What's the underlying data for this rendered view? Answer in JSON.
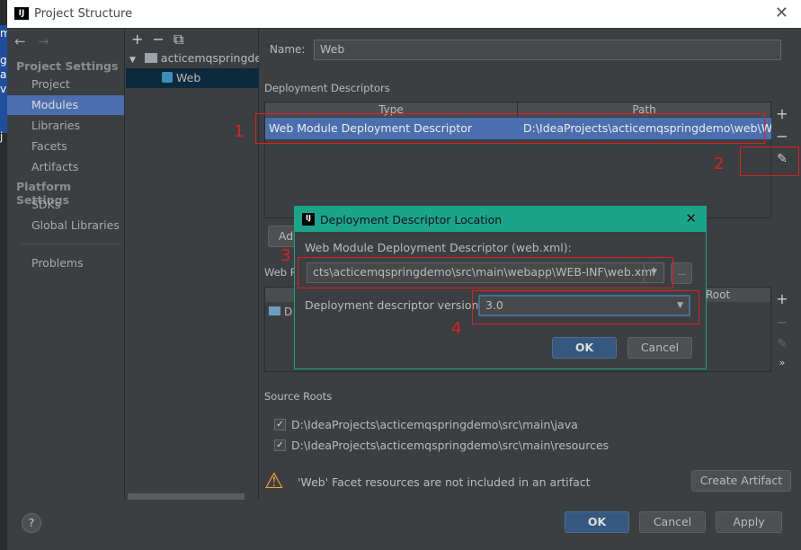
{
  "background_app": {
    "chars": [
      "m",
      "g",
      "a",
      "v",
      "j"
    ]
  },
  "window": {
    "title": "Project Structure",
    "logo": "IJ",
    "close": "✕"
  },
  "sidebar": {
    "nav_back": "←",
    "nav_forward": "→",
    "project_settings": "Project Settings",
    "platform_settings": "Platform Settings",
    "items": [
      {
        "label": "Project"
      },
      {
        "label": "Modules"
      },
      {
        "label": "Libraries"
      },
      {
        "label": "Facets"
      },
      {
        "label": "Artifacts"
      },
      {
        "label": "SDKs"
      },
      {
        "label": "Global Libraries"
      },
      {
        "label": "Problems"
      }
    ],
    "selected": "Modules"
  },
  "tree": {
    "toolbar": "+−⧉",
    "module": "acticemqspringdemo",
    "facet": "Web"
  },
  "main": {
    "name_label": "Name:",
    "name_value": "Web",
    "deployment_descriptors": "Deployment Descriptors",
    "columns": [
      "Type",
      "Path"
    ],
    "row": {
      "type": "Web Module Deployment Descriptor",
      "path": "D:\\IdeaProjects\\acticemqspringdemo\\web\\WEB"
    },
    "add_button": "Ad",
    "web_resource_label": "Web R",
    "web_root_col": "Root",
    "web_row": "D",
    "source_roots": "Source Roots",
    "source_root_items": [
      {
        "path": "D:\\IdeaProjects\\acticemqspringdemo\\src\\main\\java",
        "checked": true
      },
      {
        "path": "D:\\IdeaProjects\\acticemqspringdemo\\src\\main\\resources",
        "checked": true
      }
    ],
    "warning": "'Web' Facet resources are not included in an artifact",
    "create_artifact": "Create Artifact"
  },
  "dialog": {
    "title": "Deployment Descriptor Location",
    "logo": "IJ",
    "close": "✕",
    "descriptor_label": "Web Module Deployment Descriptor (web.xml):",
    "descriptor_path": "cts\\acticemqspringdemo\\src\\main\\webapp\\WEB-INF\\web.xml",
    "browse": "...",
    "version_label": "Deployment descriptor version",
    "version_value": "3.0",
    "ok": "OK",
    "cancel": "Cancel"
  },
  "annotations": [
    "1",
    "2",
    "3",
    "4"
  ],
  "annotation_color": "#e02020",
  "bottom": {
    "help": "?",
    "ok": "OK",
    "cancel": "Cancel",
    "apply": "Apply"
  }
}
